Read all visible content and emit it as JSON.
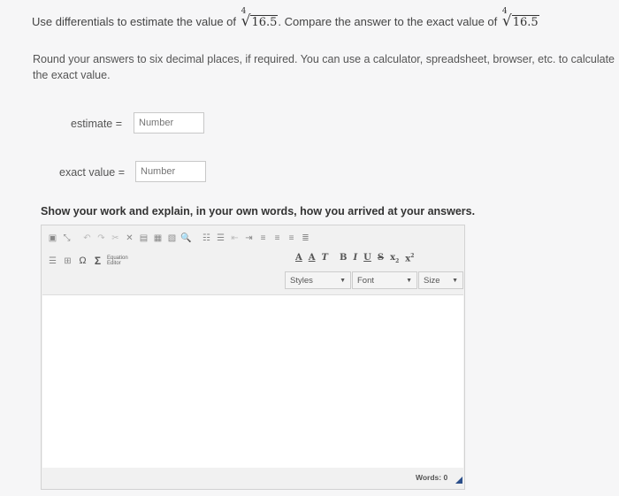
{
  "question": {
    "text_before": "Use differentials to estimate the value of",
    "text_middle": ". Compare the answer to the exact value of",
    "root_index": "4",
    "radicand": "16.5"
  },
  "instructions": "Round your answers to six decimal places, if required. You can use a calculator, spreadsheet, browser, etc. to calculate the exact value.",
  "estimate": {
    "label": "estimate =",
    "placeholder": "Number"
  },
  "exact": {
    "label": "exact value =",
    "placeholder": "Number"
  },
  "work_prompt": "Show your work and explain, in your own words, how you arrived at your answers.",
  "editor": {
    "eq_editor_line1": "Equation",
    "eq_editor_line2": "Editor",
    "format_buttons": [
      "A",
      "A",
      "T",
      "B",
      "I",
      "U",
      "S",
      "x",
      "x"
    ],
    "styles_label": "Styles",
    "font_label": "Font",
    "size_label": "Size",
    "words_label": "Words: 0"
  },
  "colors": {
    "grip": "#2b4f8a"
  }
}
